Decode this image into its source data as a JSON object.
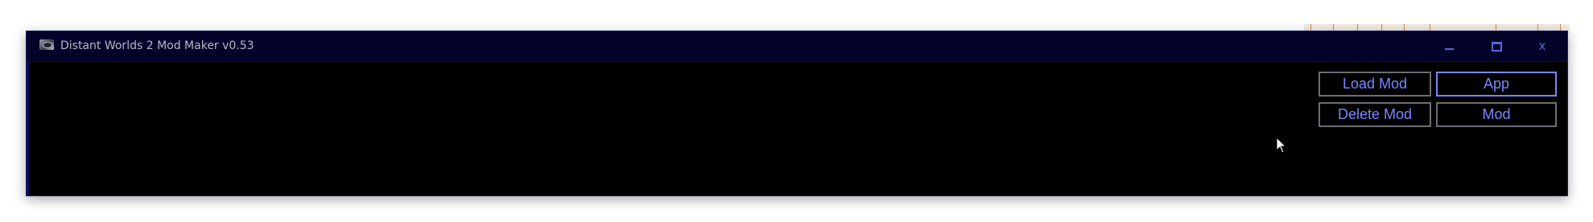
{
  "window": {
    "title": "Distant Worlds 2 Mod Maker v0.53",
    "controls": {
      "minimize_icon": "minimize-icon",
      "maximize_icon": "maximize-icon",
      "close_icon": "close-icon",
      "close_glyph": "x"
    }
  },
  "toolbar": {
    "load_mod_label": "Load Mod",
    "delete_mod_label": "Delete Mod",
    "app_label": "App",
    "mod_label": "Mod"
  },
  "colors": {
    "titlebar": "#03032a",
    "window_bg": "#000000",
    "accent": "#7a86ff",
    "button_border": "#6e6e76"
  }
}
